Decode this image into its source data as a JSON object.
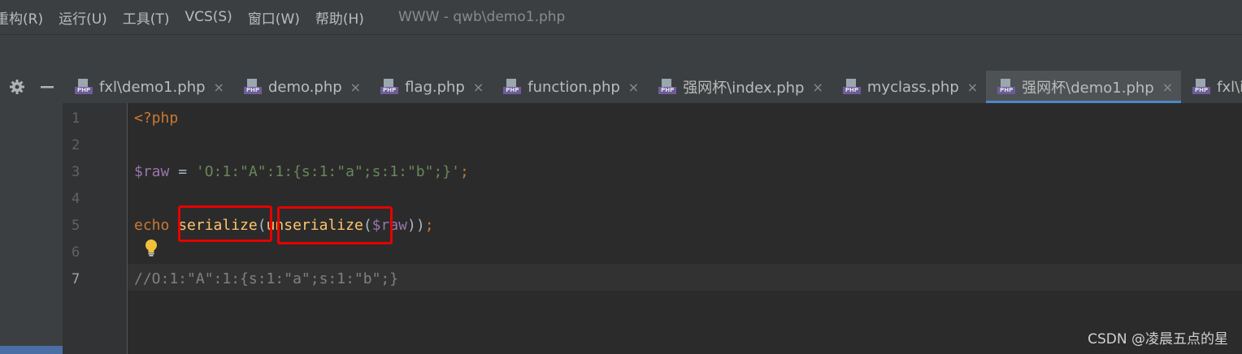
{
  "menubar": {
    "items": [
      "重构(R)",
      "运行(U)",
      "工具(T)",
      "VCS(S)",
      "窗口(W)",
      "帮助(H)"
    ],
    "window_title": "WWW - qwb\\demo1.php"
  },
  "tabs": [
    {
      "label": "fxl\\demo1.php",
      "active": false
    },
    {
      "label": "demo.php",
      "active": false
    },
    {
      "label": "flag.php",
      "active": false
    },
    {
      "label": "function.php",
      "active": false
    },
    {
      "label": "强网杯\\index.php",
      "active": false
    },
    {
      "label": "myclass.php",
      "active": false
    },
    {
      "label": "强网杯\\demo1.php",
      "active": true
    },
    {
      "label": "fxl\\ind",
      "active": false
    }
  ],
  "tab_icon_label": "PHP",
  "close_glyph": "×",
  "line_numbers": [
    "1",
    "2",
    "3",
    "4",
    "5",
    "6",
    "7"
  ],
  "code": {
    "line1": "<?php",
    "line3": {
      "var": "$raw",
      "op": " = ",
      "str": "'O:1:\"A\":1:{s:1:\"a\";s:1:\"b\";}'",
      "end": ";"
    },
    "line5": {
      "echo": "echo",
      "fn1": "serialize",
      "paren_open": "(",
      "fn2": "unserialize",
      "paren2": "(",
      "var": "$raw",
      "close": "))",
      "semi": ";"
    },
    "line7": "//O:1:\"A\":1:{s:1:\"a\";s:1:\"b\";}"
  },
  "watermark": "CSDN @凌晨五点的星",
  "colors": {
    "keyword": "#cc7832",
    "variable": "#9876aa",
    "string": "#6a8759",
    "function": "#ffc66d",
    "comment": "#808080",
    "highlight_box": "#e60000"
  }
}
